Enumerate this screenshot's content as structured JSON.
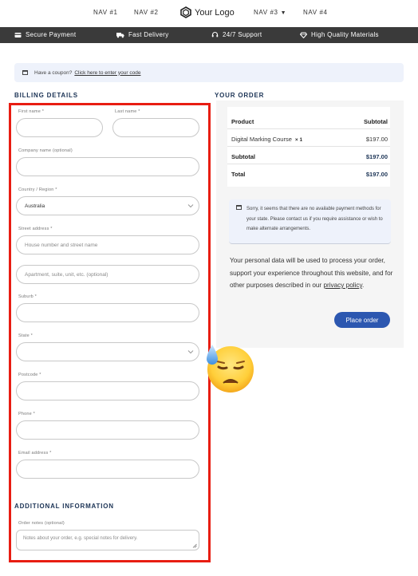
{
  "nav": {
    "items": [
      "NAV #1",
      "NAV #2",
      "NAV #3",
      "NAV #4"
    ],
    "logo_text": "Your Logo"
  },
  "features": [
    {
      "icon": "credit-card-icon",
      "label": "Secure Payment"
    },
    {
      "icon": "truck-icon",
      "label": "Fast Delivery"
    },
    {
      "icon": "headset-icon",
      "label": "24/7 Support"
    },
    {
      "icon": "diamond-icon",
      "label": "High Quality Materials"
    }
  ],
  "coupon": {
    "text": "Have a coupon?",
    "link": "Click here to enter your code"
  },
  "billing": {
    "title": "BILLING DETAILS",
    "first_name_label": "First name *",
    "last_name_label": "Last name *",
    "company_label": "Company name (optional)",
    "country_label": "Country / Region *",
    "country_value": "Australia",
    "street_label": "Street address *",
    "street_placeholder": "House number and street name",
    "apartment_placeholder": "Apartment, suite, unit, etc. (optional)",
    "suburb_label": "Suburb *",
    "state_label": "State *",
    "postcode_label": "Postcode *",
    "phone_label": "Phone *",
    "email_label": "Email address *"
  },
  "additional": {
    "title": "ADDITIONAL INFORMATION",
    "notes_label": "Order notes (optional)",
    "notes_placeholder": "Notes about your order, e.g. special notes for delivery."
  },
  "order": {
    "title": "YOUR ORDER",
    "col_product": "Product",
    "col_subtotal": "Subtotal",
    "item_name": "Digital Marking Course",
    "item_qty": "× 1",
    "item_price": "$197.00",
    "subtotal_label": "Subtotal",
    "subtotal_value": "$197.00",
    "total_label": "Total",
    "total_value": "$197.00"
  },
  "payment_notice": "Sorry, it seems that there are no available payment methods for your state. Please contact us if you require assistance or wish to make alternate arrangements.",
  "privacy": {
    "text": "Your personal data will be used to process your order, support your experience throughout this website, and for other purposes described in our",
    "link": "privacy policy",
    "end": "."
  },
  "place_order_label": "Place order",
  "colors": {
    "accent": "#2c57b0",
    "heading": "#1b3355",
    "feature_bar": "#3a3a3a",
    "highlight_frame": "#e81d12"
  }
}
